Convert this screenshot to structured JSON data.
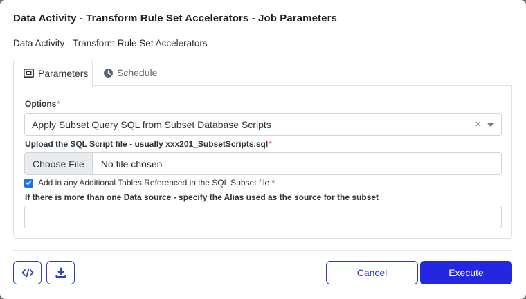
{
  "dialog": {
    "title": "Data Activity - Transform Rule Set Accelerators - Job Parameters",
    "subtitle": "Data Activity - Transform Rule Set Accelerators"
  },
  "tabs": [
    {
      "label": "Parameters",
      "icon": "parameters-icon",
      "active": true
    },
    {
      "label": "Schedule",
      "icon": "clock-icon",
      "active": false
    }
  ],
  "form": {
    "options_label": "Options",
    "required_marker": "*",
    "options_value": "Apply Subset Query SQL from Subset Database Scripts",
    "clear_symbol": "×",
    "upload_label": "Upload the SQL Script file - usually xxx201_SubsetScripts.sql",
    "choose_file_label": "Choose File",
    "no_file_text": "No file chosen",
    "checkbox_label": "Add in any Additional Tables Referenced in the SQL Subset file *",
    "checkbox_checked": true,
    "alias_label": "If there is more than one Data source - specify the Alias used as the source for the subset",
    "alias_value": ""
  },
  "footer": {
    "code_button_icon": "code-icon",
    "download_button_icon": "download-icon",
    "cancel_label": "Cancel",
    "execute_label": "Execute"
  },
  "colors": {
    "primary": "#2427e0",
    "checkbox": "#1a73e8",
    "required": "#e05a5a"
  }
}
